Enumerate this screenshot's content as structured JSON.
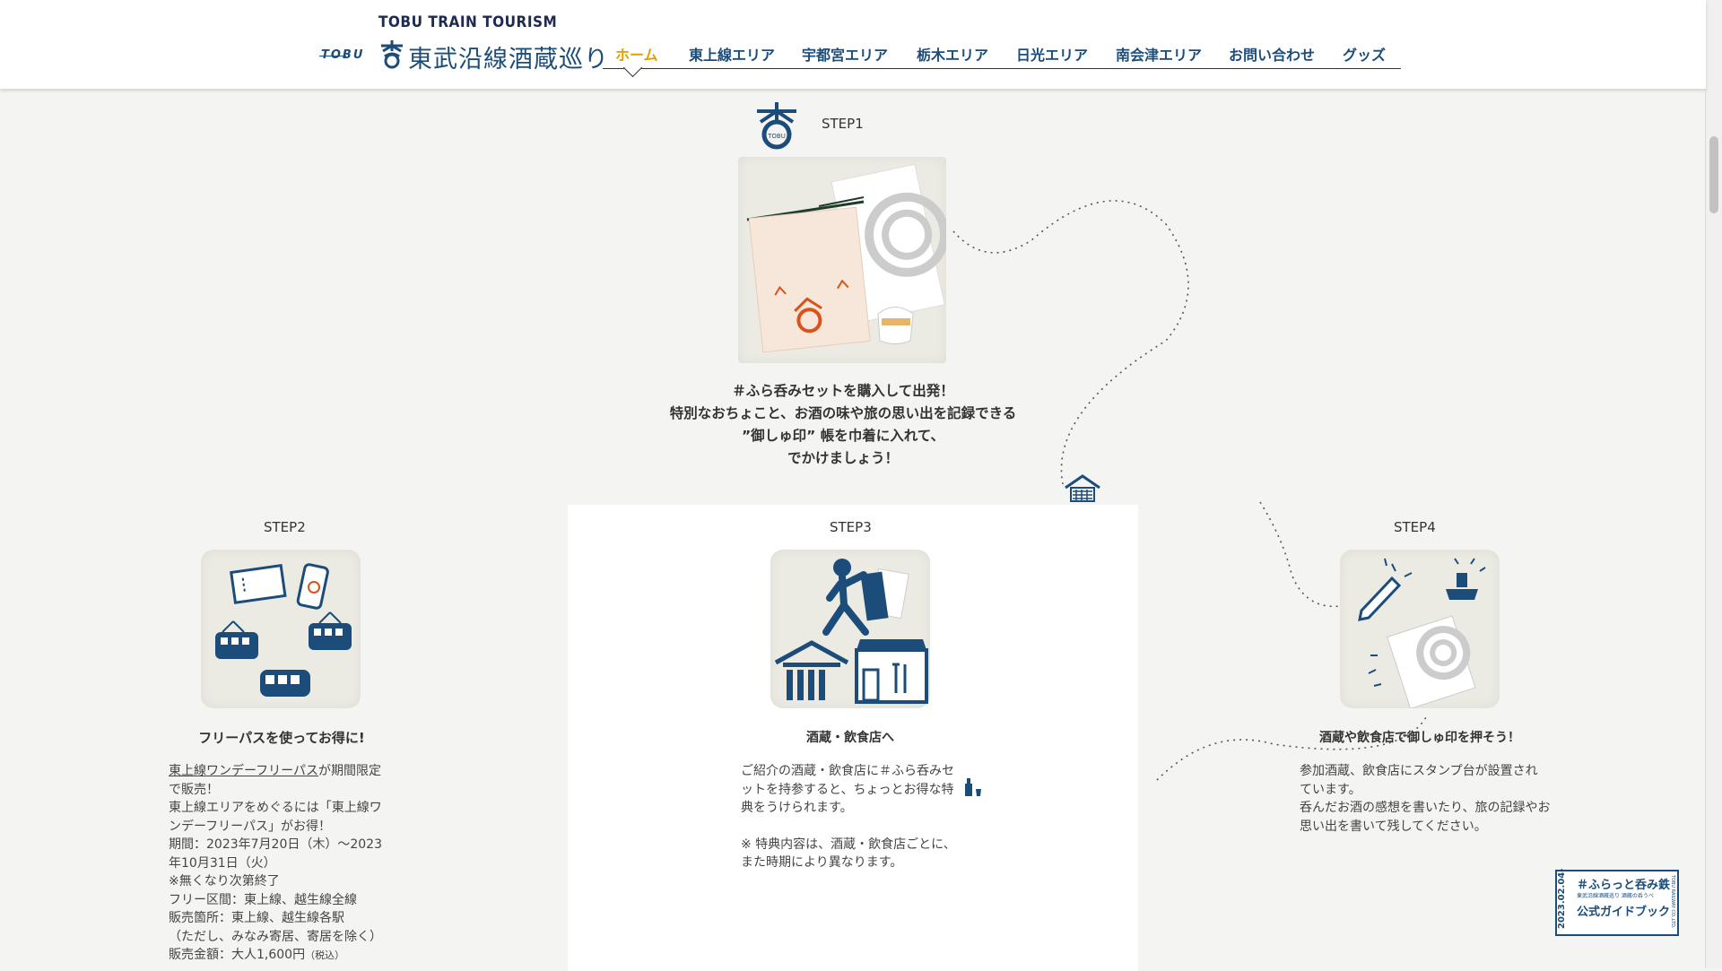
{
  "header": {
    "brand_top": "TOBU TRAIN TOURISM",
    "brand_tobu": "TOBU",
    "brand_name": "東武沿線酒蔵巡り",
    "nav": [
      {
        "label": "ホーム",
        "active": true
      },
      {
        "label": "東上線エリア"
      },
      {
        "label": "宇都宮エリア"
      },
      {
        "label": "栃木エリア"
      },
      {
        "label": "日光エリア"
      },
      {
        "label": "南会津エリア"
      },
      {
        "label": "お問い合わせ"
      },
      {
        "label": "グッズ"
      }
    ]
  },
  "step1": {
    "label": "STEP1",
    "lines": [
      "＃ふら呑みセットを購入して出発！",
      "特別なおちょこと、お酒の味や旅の思い出を記録できる",
      "”御しゅ印” 帳を巾着に入れて、",
      "でかけましょう！"
    ]
  },
  "step2": {
    "label": "STEP2",
    "caption": "フリーパスを使ってお得に!",
    "link": "東上線ワンデーフリーパス",
    "text_after_link": "が期間限定",
    "lines": [
      "で販売！",
      "東上線エリアをめぐるには「東上線ワ",
      "ンデーフリーパス」がお得！",
      "期間：2023年7月20日（木）～2023",
      "年10月31日（火）",
      "※無くなり次第終了",
      "フリー区間：東上線、越生線全線",
      "販売箇所：東上線、越生線各駅",
      "（ただし、みなみ寄居、寄居を除く）"
    ],
    "price_label": "販売金額：大人1,600円",
    "price_tax": "（税込）"
  },
  "step3": {
    "label": "STEP3",
    "caption": "酒蔵・飲食店へ",
    "lines": [
      "ご紹介の酒蔵・飲食店に＃ふら呑みセ",
      "ットを持参すると、ちょっとお得な特",
      "典をうけられます。",
      "",
      "※ 特典内容は、酒蔵・飲食店ごとに、",
      "また時期により異なります。"
    ]
  },
  "step4": {
    "label": "STEP4",
    "caption": "酒蔵や飲食店で御しゅ印を押そう！",
    "lines": [
      "参加酒蔵、飲食店にスタンプ台が設置され",
      "ています。",
      "呑んだお酒の感想を書いたり、旅の記録やお",
      "思い出を書いて残してください。"
    ]
  },
  "guide_badge": {
    "date": "2023.02.04-",
    "title": "＃ふらっと呑み鉄",
    "sub": "東武沿線酒蔵巡り 酒蔵の呑うべ",
    "label": "公式ガイドブック",
    "side": "TOBU RAILWAY CO.,LTD."
  },
  "colors": {
    "brand_navy": "#1b4c7a",
    "active_nav": "#e0a100",
    "accent_orange": "#d8531c",
    "paper": "#ecebe3"
  }
}
